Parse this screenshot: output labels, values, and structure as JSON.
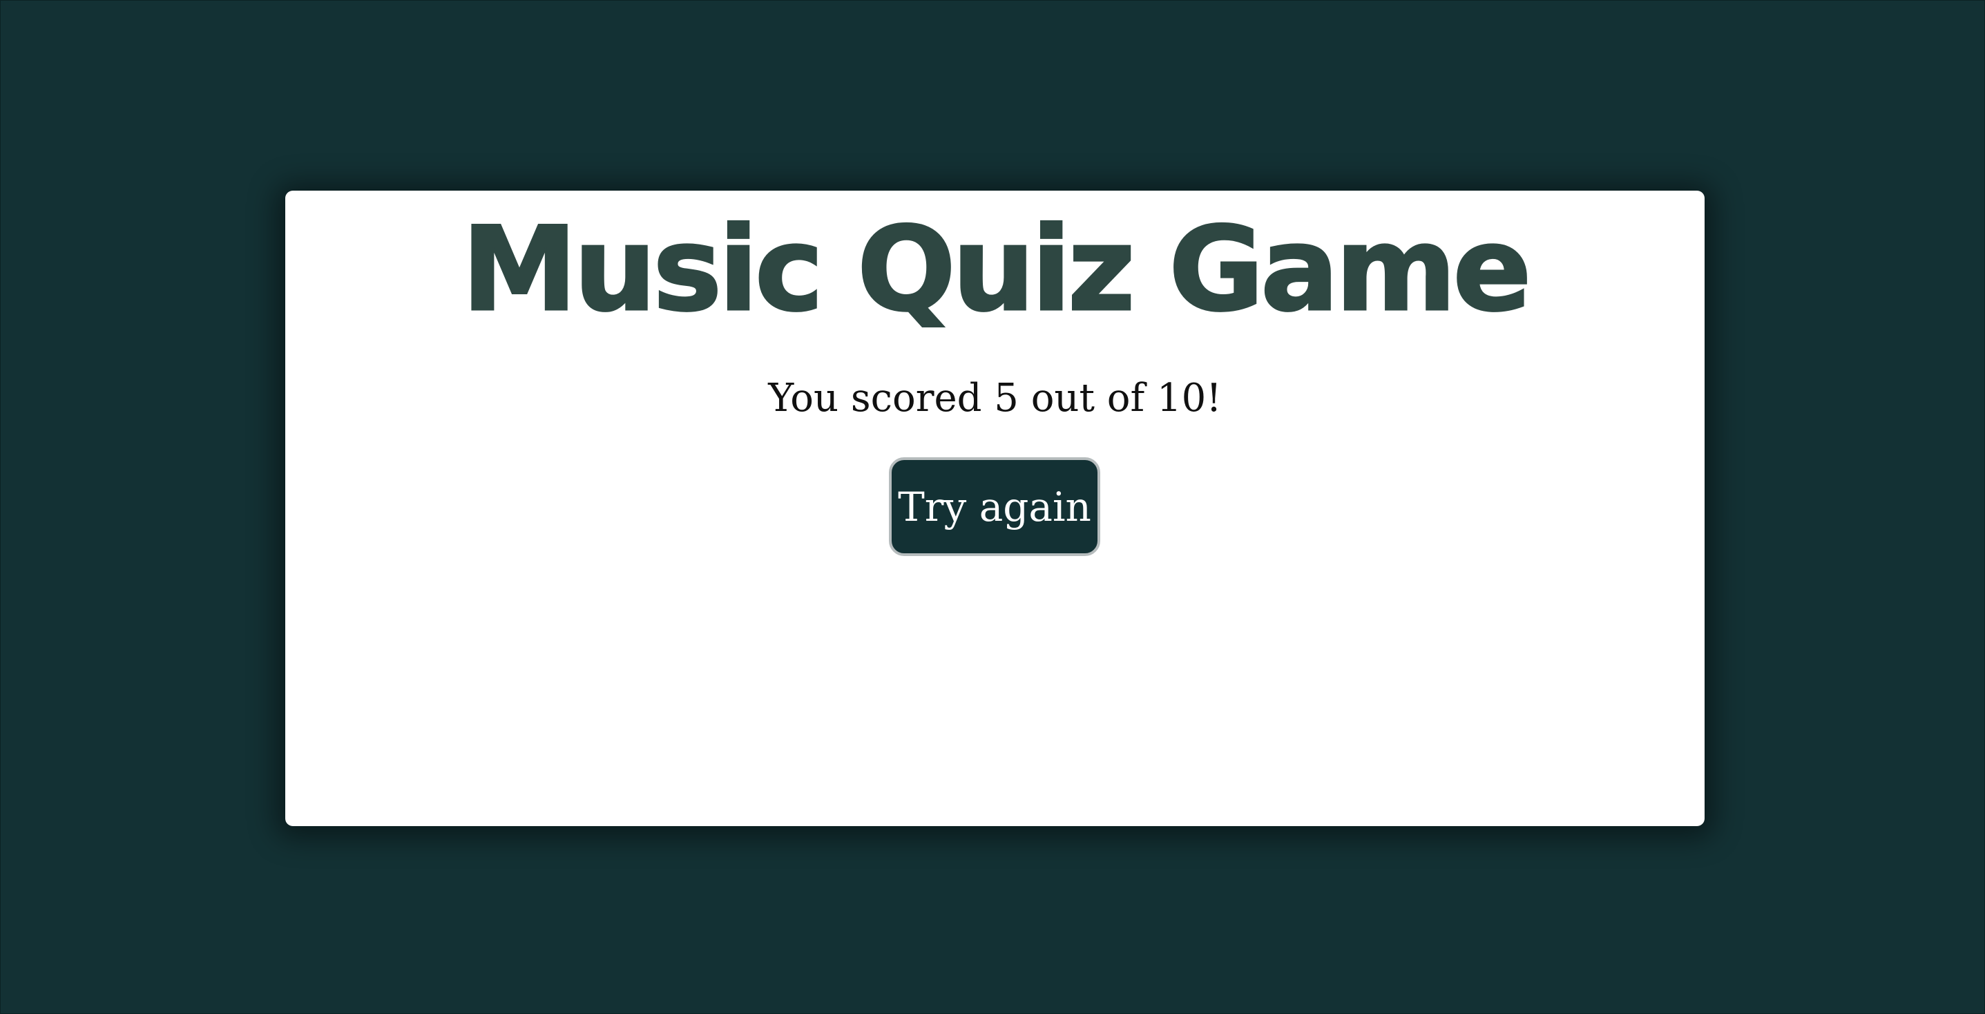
{
  "quiz": {
    "title": "Music Quiz Game",
    "result_text": "You scored 5 out of 10!",
    "score": 5,
    "total": 10,
    "retry_label": "Try again"
  },
  "colors": {
    "background": "#133134",
    "card": "#ffffff",
    "title": "#2e4742",
    "button_bg": "#133134",
    "button_text": "#ffffff"
  }
}
